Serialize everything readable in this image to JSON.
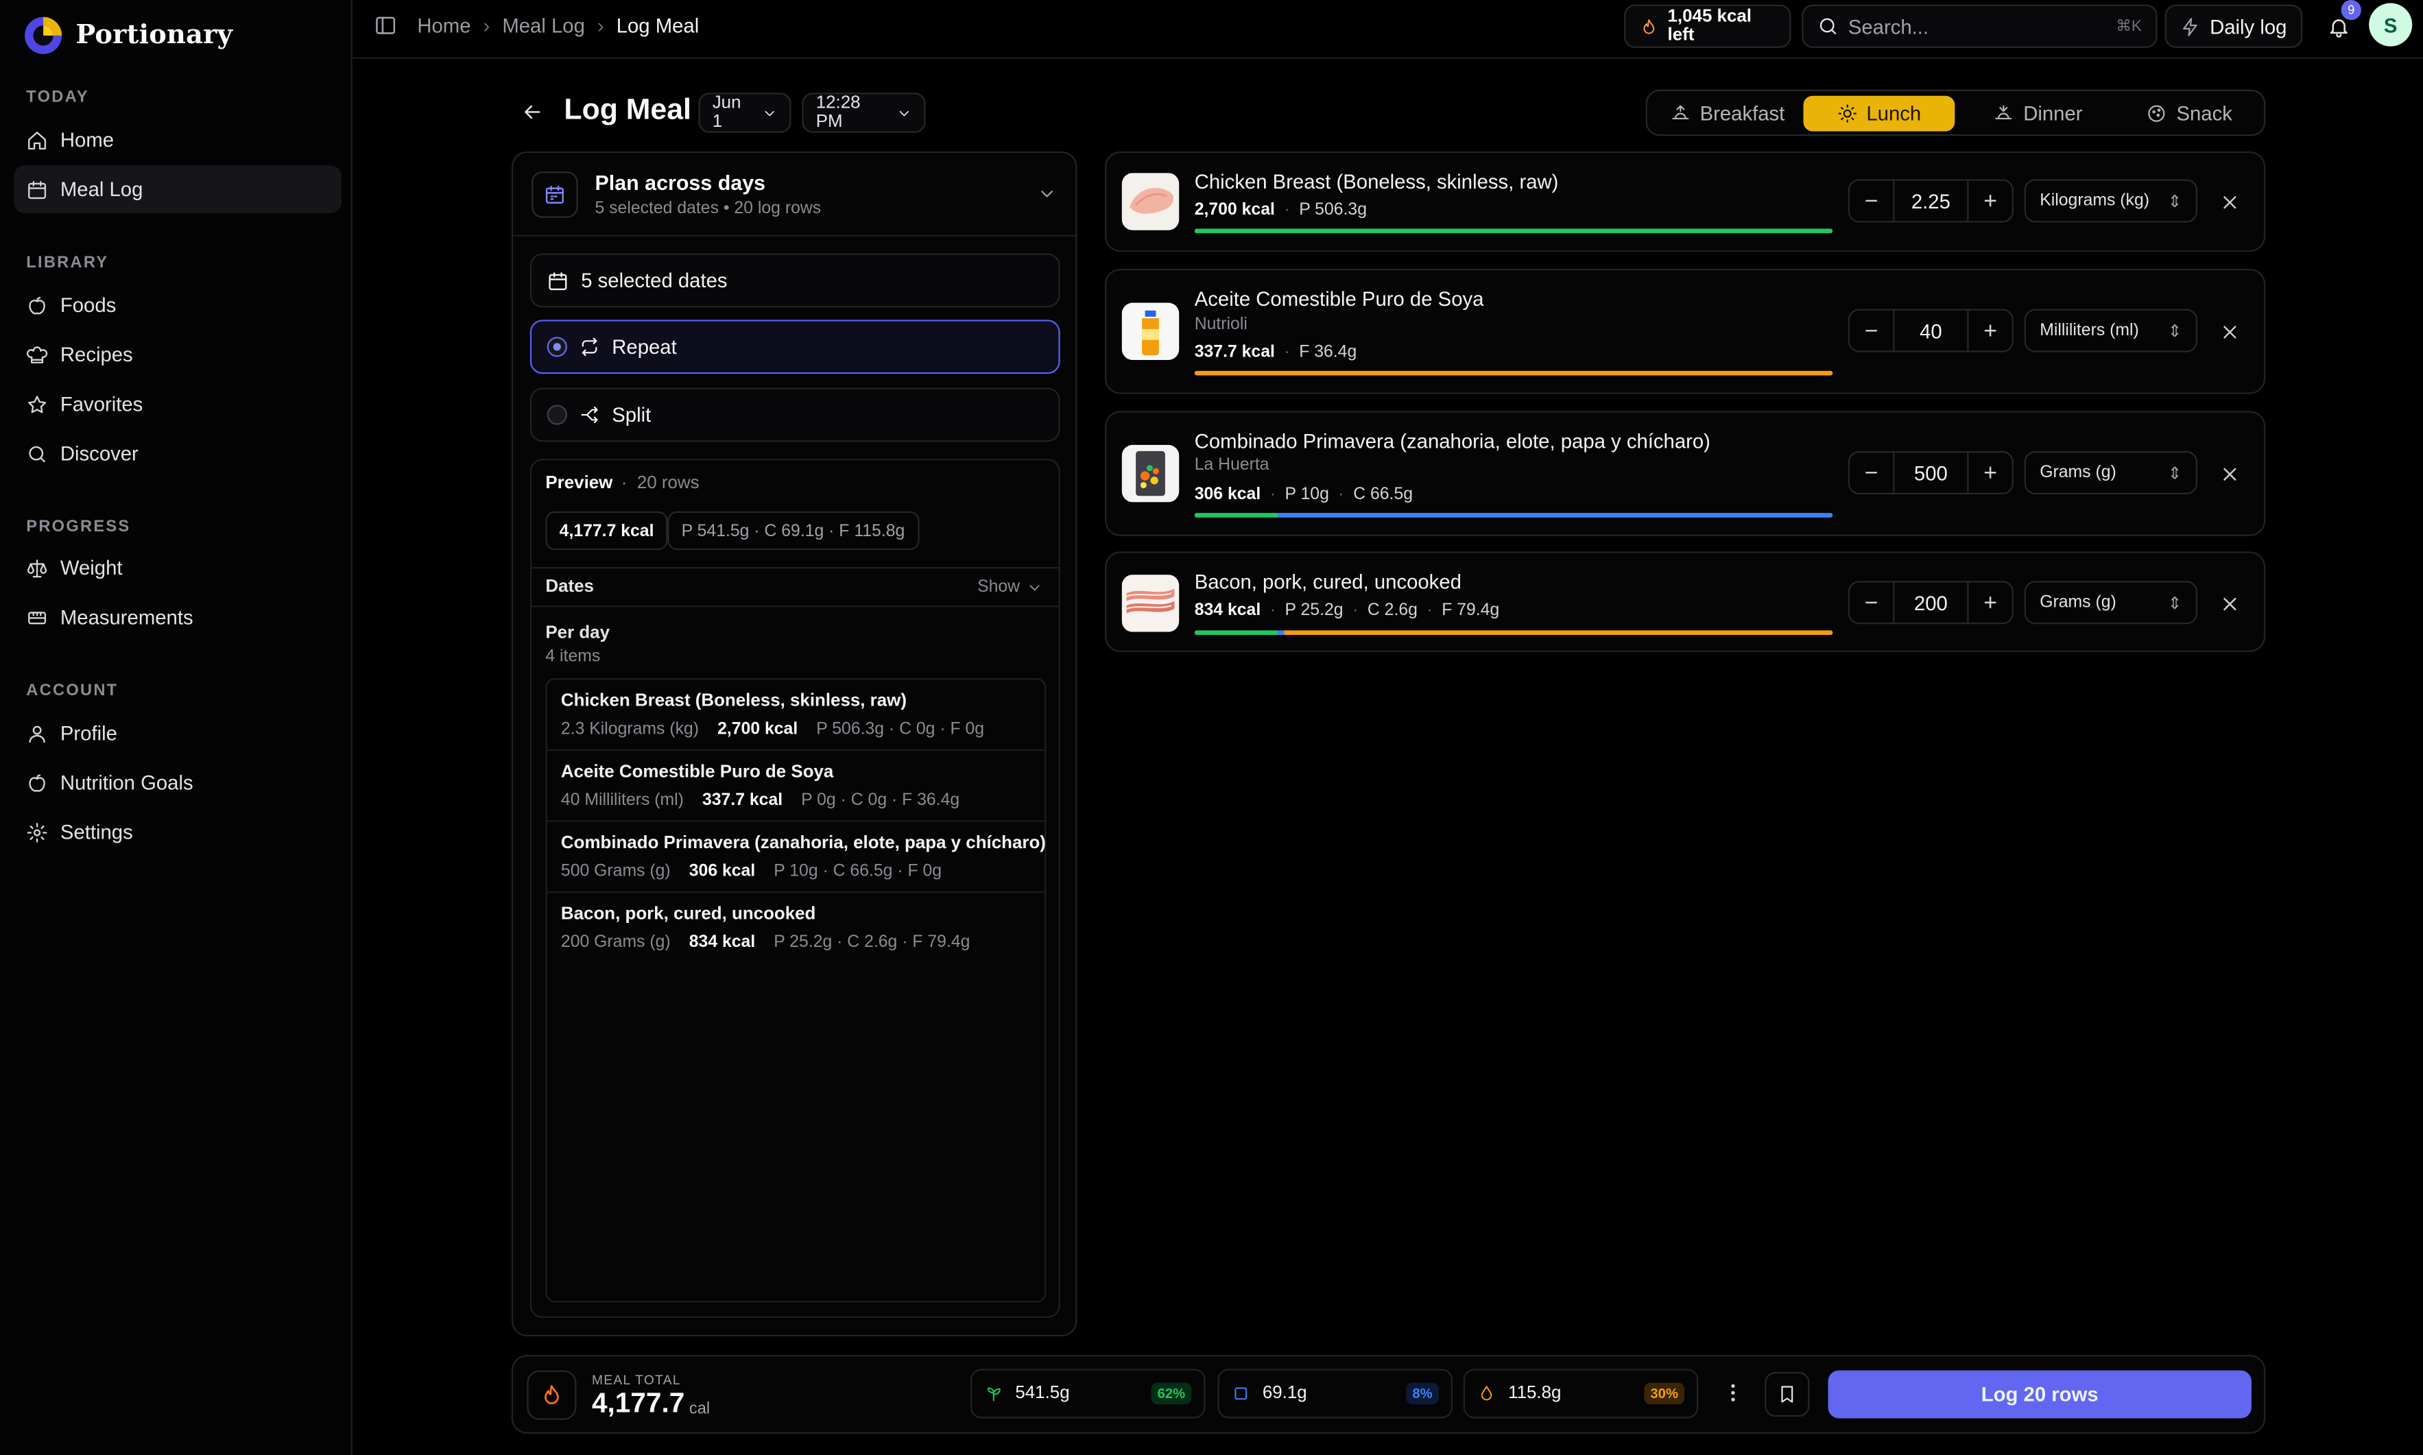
{
  "app": {
    "name": "Portionary"
  },
  "sidebar": {
    "sections": [
      {
        "title": "TODAY",
        "items": [
          {
            "label": "Home",
            "icon": "home-icon"
          },
          {
            "label": "Meal Log",
            "icon": "calendar-icon",
            "active": true
          }
        ]
      },
      {
        "title": "LIBRARY",
        "items": [
          {
            "label": "Foods",
            "icon": "apple-icon"
          },
          {
            "label": "Recipes",
            "icon": "chef-hat-icon"
          },
          {
            "label": "Favorites",
            "icon": "star-icon"
          },
          {
            "label": "Discover",
            "icon": "search-icon"
          }
        ]
      },
      {
        "title": "PROGRESS",
        "items": [
          {
            "label": "Weight",
            "icon": "scale-icon"
          },
          {
            "label": "Measurements",
            "icon": "ruler-icon"
          }
        ]
      },
      {
        "title": "ACCOUNT",
        "items": [
          {
            "label": "Profile",
            "icon": "user-icon"
          },
          {
            "label": "Nutrition Goals",
            "icon": "apple-icon"
          },
          {
            "label": "Settings",
            "icon": "gear-icon"
          }
        ]
      }
    ]
  },
  "topbar": {
    "breadcrumbs": [
      "Home",
      "Meal Log",
      "Log Meal"
    ],
    "kcal_left": "1,045 kcal left",
    "search_placeholder": "Search...",
    "search_shortcut": "⌘K",
    "daily_log": "Daily log",
    "notifications": "9",
    "avatar_initial": "S"
  },
  "header": {
    "title": "Log Meal",
    "date": "Jun 1",
    "time": "12:28 PM",
    "meal_tabs": [
      "Breakfast",
      "Lunch",
      "Dinner",
      "Snack"
    ],
    "active_meal": "Lunch"
  },
  "plan": {
    "title": "Plan across days",
    "subtitle": "5 selected dates • 20 log rows",
    "selected_dates": "5 selected dates",
    "modes": [
      "Repeat",
      "Split"
    ],
    "active_mode": "Repeat",
    "preview_label": "Preview",
    "preview_rows": "20 rows",
    "total_kcal": "4,177.7 kcal",
    "total_macros": "P 541.5g · C 69.1g · F 115.8g",
    "dates_label": "Dates",
    "dates_toggle": "Show",
    "per_day_label": "Per day",
    "per_day_count": "4 items",
    "per_day_items": [
      {
        "name": "Chicken Breast (Boneless, skinless, raw)",
        "amount": "2.3 Kilograms (kg)",
        "kcal": "2,700 kcal",
        "macros": "P 506.3g · C 0g · F 0g"
      },
      {
        "name": "Aceite Comestible Puro de Soya",
        "amount": "40 Milliliters (ml)",
        "kcal": "337.7 kcal",
        "macros": "P 0g · C 0g · F 36.4g"
      },
      {
        "name": "Combinado Primavera (zanahoria, elote, papa y chícharo)",
        "amount": "500 Grams (g)",
        "kcal": "306 kcal",
        "macros": "P 10g · C 66.5g · F 0g"
      },
      {
        "name": "Bacon, pork, cured, uncooked",
        "amount": "200 Grams (g)",
        "kcal": "834 kcal",
        "macros": "P 25.2g · C 2.6g · F 79.4g"
      }
    ]
  },
  "foods": [
    {
      "name": "Chicken Breast (Boneless, skinless, raw)",
      "brand": "",
      "kcal": "2,700 kcal",
      "macros": [
        "P 506.3g"
      ],
      "quantity": "2.25",
      "unit": "Kilograms (kg)",
      "thumb": "chicken-image",
      "macro_split": {
        "protein": 1.0,
        "carbs": 0.0,
        "fat": 0.0
      }
    },
    {
      "name": "Aceite Comestible Puro de Soya",
      "brand": "Nutrioli",
      "kcal": "337.7 kcal",
      "macros": [
        "F 36.4g"
      ],
      "quantity": "40",
      "unit": "Milliliters (ml)",
      "thumb": "oil-bottle-image",
      "macro_split": {
        "protein": 0.0,
        "carbs": 0.0,
        "fat": 1.0
      }
    },
    {
      "name": "Combinado Primavera (zanahoria, elote, papa y chícharo)",
      "brand": "La Huerta",
      "kcal": "306 kcal",
      "macros": [
        "P 10g",
        "C 66.5g"
      ],
      "quantity": "500",
      "unit": "Grams (g)",
      "thumb": "vegetable-bag-image",
      "macro_split": {
        "protein": 0.13,
        "carbs": 0.87,
        "fat": 0.0
      }
    },
    {
      "name": "Bacon, pork, cured, uncooked",
      "brand": "",
      "kcal": "834 kcal",
      "macros": [
        "P 25.2g",
        "C 2.6g",
        "F 79.4g"
      ],
      "quantity": "200",
      "unit": "Grams (g)",
      "thumb": "bacon-image",
      "macro_split": {
        "protein": 0.13,
        "carbs": 0.01,
        "fat": 0.86
      }
    }
  ],
  "bottom": {
    "label": "MEAL TOTAL",
    "total": "4,177.7",
    "unit": "cal",
    "protein": {
      "value": "541.5g",
      "pct": "62%",
      "color": "#22c55e",
      "icon": "sprout-icon"
    },
    "carbs": {
      "value": "69.1g",
      "pct": "8%",
      "color": "#3b82f6",
      "icon": "square-icon"
    },
    "fat": {
      "value": "115.8g",
      "pct": "30%",
      "color": "#f59e0b",
      "icon": "droplet-icon"
    },
    "log_button": "Log 20 rows"
  },
  "colors": {
    "accent": "#6366f1",
    "active_meal": "#eab308",
    "protein": "#22c55e",
    "carbs": "#3b82f6",
    "fat": "#f59e0b"
  }
}
